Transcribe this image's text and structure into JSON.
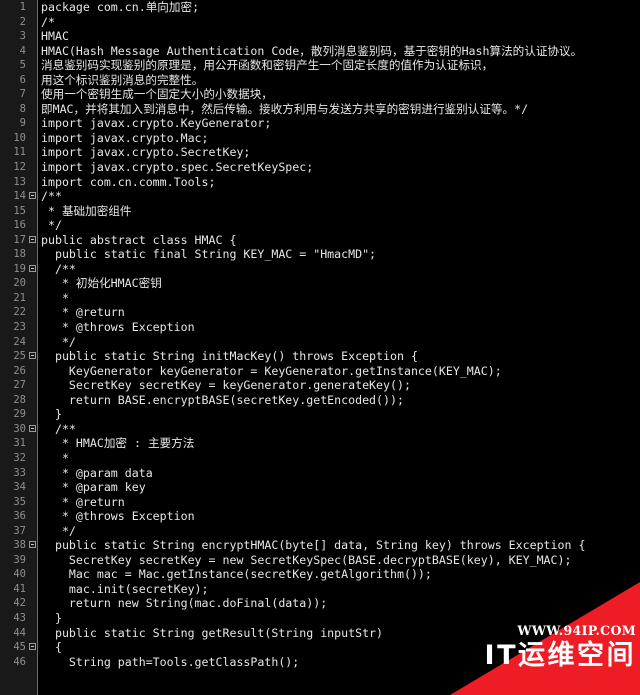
{
  "editor": {
    "language": "java",
    "background_color": "#000000",
    "gutter_color": "#191919",
    "text_color": "#e6e6e6",
    "line_number_color": "#8f8f8f",
    "first_line": 1,
    "last_line": 46
  },
  "lines": [
    {
      "n": "1",
      "fold": false,
      "text": "package com.cn.单向加密;"
    },
    {
      "n": "2",
      "fold": false,
      "text": "/*"
    },
    {
      "n": "3",
      "fold": false,
      "text": "HMAC"
    },
    {
      "n": "4",
      "fold": false,
      "text": "HMAC(Hash Message Authentication Code，散列消息鉴别码，基于密钥的Hash算法的认证协议。"
    },
    {
      "n": "5",
      "fold": false,
      "text": "消息鉴别码实现鉴别的原理是，用公开函数和密钥产生一个固定长度的值作为认证标识，"
    },
    {
      "n": "6",
      "fold": false,
      "text": "用这个标识鉴别消息的完整性。"
    },
    {
      "n": "7",
      "fold": false,
      "text": "使用一个密钥生成一个固定大小的小数据块，"
    },
    {
      "n": "8",
      "fold": false,
      "text": "即MAC，并将其加入到消息中，然后传输。接收方利用与发送方共享的密钥进行鉴别认证等。*/"
    },
    {
      "n": "9",
      "fold": false,
      "text": "import javax.crypto.KeyGenerator;"
    },
    {
      "n": "10",
      "fold": false,
      "text": "import javax.crypto.Mac;"
    },
    {
      "n": "11",
      "fold": false,
      "text": "import javax.crypto.SecretKey;"
    },
    {
      "n": "12",
      "fold": false,
      "text": "import javax.crypto.spec.SecretKeySpec;"
    },
    {
      "n": "13",
      "fold": false,
      "text": "import com.cn.comm.Tools;"
    },
    {
      "n": "14",
      "fold": true,
      "text": "/**"
    },
    {
      "n": "15",
      "fold": false,
      "text": " * 基础加密组件"
    },
    {
      "n": "16",
      "fold": false,
      "text": " */"
    },
    {
      "n": "17",
      "fold": true,
      "text": "public abstract class HMAC {"
    },
    {
      "n": "18",
      "fold": false,
      "text": "  public static final String KEY_MAC = \"HmacMD\";"
    },
    {
      "n": "19",
      "fold": true,
      "text": "  /**"
    },
    {
      "n": "20",
      "fold": false,
      "text": "   * 初始化HMAC密钥"
    },
    {
      "n": "21",
      "fold": false,
      "text": "   *"
    },
    {
      "n": "22",
      "fold": false,
      "text": "   * @return"
    },
    {
      "n": "23",
      "fold": false,
      "text": "   * @throws Exception"
    },
    {
      "n": "24",
      "fold": false,
      "text": "   */"
    },
    {
      "n": "25",
      "fold": true,
      "text": "  public static String initMacKey() throws Exception {"
    },
    {
      "n": "26",
      "fold": false,
      "text": "    KeyGenerator keyGenerator = KeyGenerator.getInstance(KEY_MAC);"
    },
    {
      "n": "27",
      "fold": false,
      "text": "    SecretKey secretKey = keyGenerator.generateKey();"
    },
    {
      "n": "28",
      "fold": false,
      "text": "    return BASE.encryptBASE(secretKey.getEncoded());"
    },
    {
      "n": "29",
      "fold": false,
      "text": "  }"
    },
    {
      "n": "30",
      "fold": true,
      "text": "  /**"
    },
    {
      "n": "31",
      "fold": false,
      "text": "   * HMAC加密 : 主要方法"
    },
    {
      "n": "32",
      "fold": false,
      "text": "   *"
    },
    {
      "n": "33",
      "fold": false,
      "text": "   * @param data"
    },
    {
      "n": "34",
      "fold": false,
      "text": "   * @param key"
    },
    {
      "n": "35",
      "fold": false,
      "text": "   * @return"
    },
    {
      "n": "36",
      "fold": false,
      "text": "   * @throws Exception"
    },
    {
      "n": "37",
      "fold": false,
      "text": "   */"
    },
    {
      "n": "38",
      "fold": true,
      "text": "  public static String encryptHMAC(byte[] data, String key) throws Exception {"
    },
    {
      "n": "39",
      "fold": false,
      "text": "    SecretKey secretKey = new SecretKeySpec(BASE.decryptBASE(key), KEY_MAC);"
    },
    {
      "n": "40",
      "fold": false,
      "text": "    Mac mac = Mac.getInstance(secretKey.getAlgorithm());"
    },
    {
      "n": "41",
      "fold": false,
      "text": "    mac.init(secretKey);"
    },
    {
      "n": "42",
      "fold": false,
      "text": "    return new String(mac.doFinal(data));"
    },
    {
      "n": "43",
      "fold": false,
      "text": "  }"
    },
    {
      "n": "44",
      "fold": false,
      "text": "  public static String getResult(String inputStr)"
    },
    {
      "n": "45",
      "fold": true,
      "text": "  {"
    },
    {
      "n": "46",
      "fold": false,
      "text": "    String path=Tools.getClassPath();"
    }
  ],
  "watermark": {
    "url": "WWW.94IP.COM",
    "name": "IT运维空间",
    "color": "#ee1c25",
    "text_color": "#ffffff"
  }
}
